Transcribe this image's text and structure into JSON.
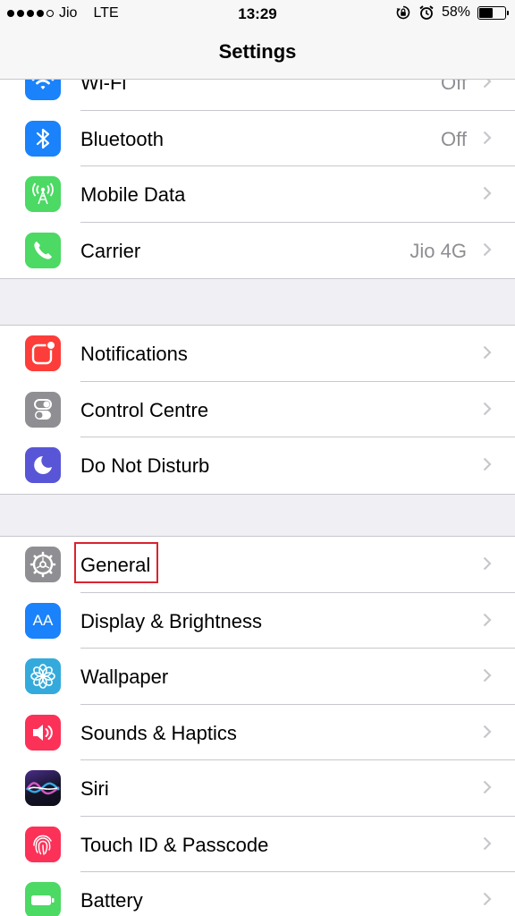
{
  "status_bar": {
    "carrier": "Jio",
    "network": "LTE",
    "time": "13:29",
    "battery_percent": "58%",
    "battery_level": 0.58,
    "icons": [
      "signal-dots-icon",
      "orientation-lock-icon",
      "alarm-icon",
      "battery-icon"
    ]
  },
  "nav": {
    "title": "Settings"
  },
  "colors": {
    "wifi": "#1a82fb",
    "bluetooth": "#1a82fb",
    "mobile_data": "#4cd964",
    "carrier": "#4cd964",
    "notifications": "#fc3d39",
    "control_centre": "#8e8e93",
    "do_not_disturb": "#5856d6",
    "general": "#8e8e93",
    "display": "#1a82fb",
    "wallpaper": "#34aadc",
    "sounds": "#fc3158",
    "touch_id": "#fc3158",
    "battery": "#4cd964",
    "highlight": "#d9232e"
  },
  "groups": [
    {
      "rows": [
        {
          "label": "Wi-Fi",
          "value": "Off",
          "icon": "wifi-icon"
        },
        {
          "label": "Bluetooth",
          "value": "Off",
          "icon": "bluetooth-icon"
        },
        {
          "label": "Mobile Data",
          "value": "",
          "icon": "antenna-icon"
        },
        {
          "label": "Carrier",
          "value": "Jio 4G",
          "icon": "phone-icon"
        }
      ]
    },
    {
      "rows": [
        {
          "label": "Notifications",
          "value": "",
          "icon": "notifications-icon"
        },
        {
          "label": "Control Centre",
          "value": "",
          "icon": "toggles-icon"
        },
        {
          "label": "Do Not Disturb",
          "value": "",
          "icon": "moon-icon"
        }
      ]
    },
    {
      "rows": [
        {
          "label": "General",
          "value": "",
          "icon": "gear-icon"
        },
        {
          "label": "Display & Brightness",
          "value": "",
          "icon": "text-size-icon"
        },
        {
          "label": "Wallpaper",
          "value": "",
          "icon": "flower-icon"
        },
        {
          "label": "Sounds & Haptics",
          "value": "",
          "icon": "speaker-icon"
        },
        {
          "label": "Siri",
          "value": "",
          "icon": "siri-icon"
        },
        {
          "label": "Touch ID & Passcode",
          "value": "",
          "icon": "fingerprint-icon"
        },
        {
          "label": "Battery",
          "value": "",
          "icon": "battery-settings-icon"
        }
      ]
    }
  ],
  "display_icon_text": "AA"
}
